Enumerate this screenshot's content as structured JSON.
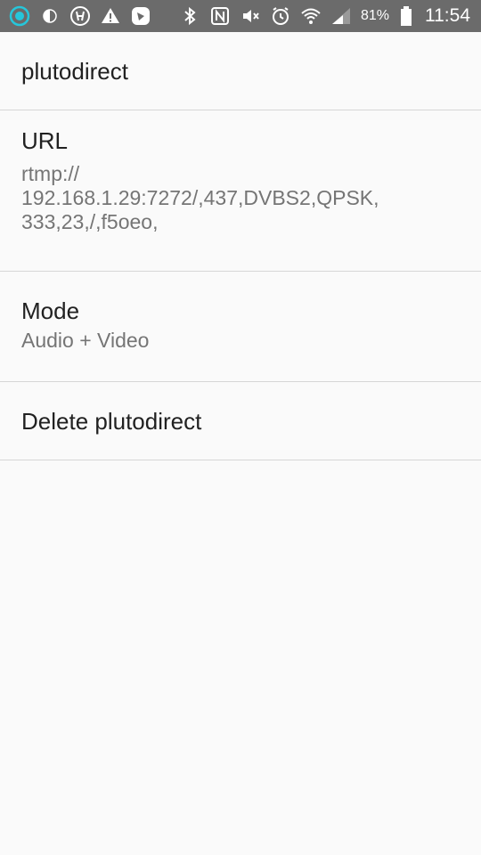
{
  "status_bar": {
    "battery_percent": "81%",
    "time": "11:54",
    "left_icons": [
      "app-notification-icon",
      "data-saver-icon",
      "vpn-icon",
      "warning-icon",
      "app-icon"
    ],
    "right_icons": [
      "bluetooth-icon",
      "nfc-icon",
      "mute-icon",
      "alarm-icon",
      "wifi-icon",
      "signal-icon",
      "battery-icon"
    ],
    "background": "#6b6b6b",
    "accent": "#26c6da"
  },
  "preferences": {
    "name": {
      "title": "plutodirect"
    },
    "url": {
      "title": "URL",
      "value": "rtmp://\n192.168.1.29:7272/,437,DVBS2,QPSK,\n333,23,/,f5oeo,"
    },
    "mode": {
      "title": "Mode",
      "value": "Audio + Video"
    },
    "delete": {
      "title": "Delete plutodirect"
    }
  },
  "colors": {
    "page_background": "#fafafa",
    "title_text": "#212121",
    "summary_text": "#757575",
    "divider": "#d6d6d6"
  }
}
